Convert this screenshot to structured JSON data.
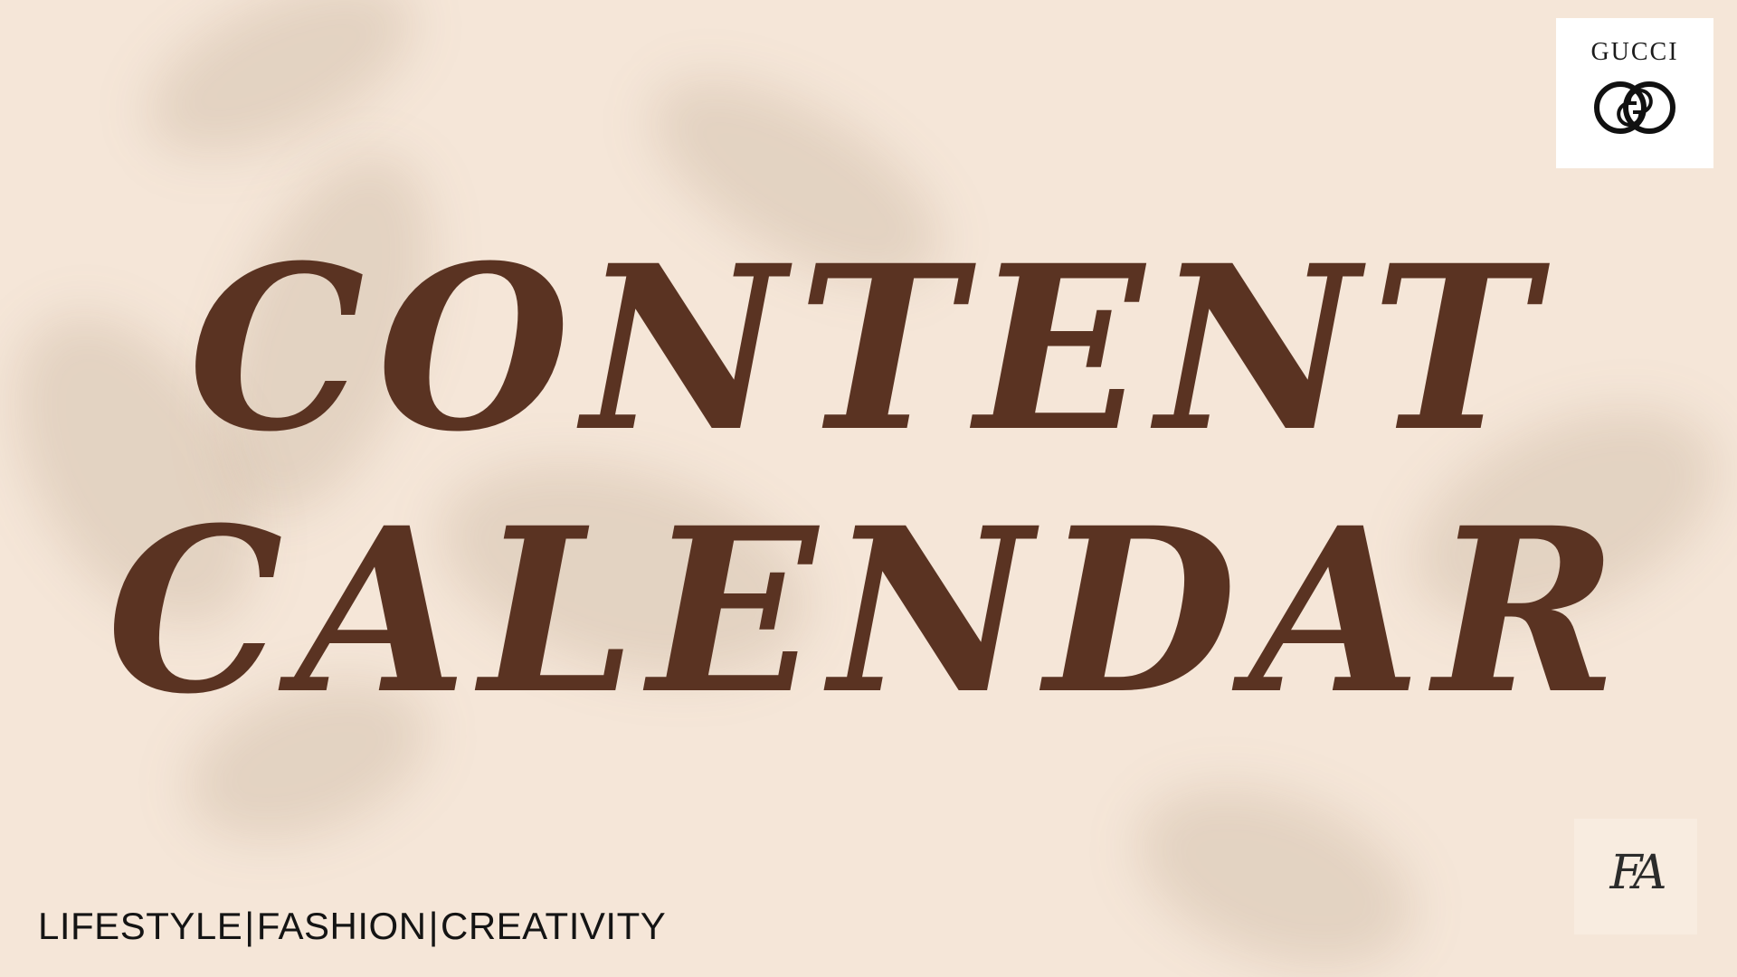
{
  "slide": {
    "title_line_1": "CONTENT",
    "title_line_2": "CALENDAR",
    "tagline": [
      "LIFESTYLE",
      "FASHION",
      "CREATIVITY"
    ],
    "tagline_separator": "|",
    "brand": {
      "name": "GUCCI",
      "logo_icon": "double-g-logo-icon"
    },
    "monogram": "FA",
    "colors": {
      "background": "#f5e6d8",
      "title": "#5a3322",
      "tagline": "#141414"
    }
  }
}
